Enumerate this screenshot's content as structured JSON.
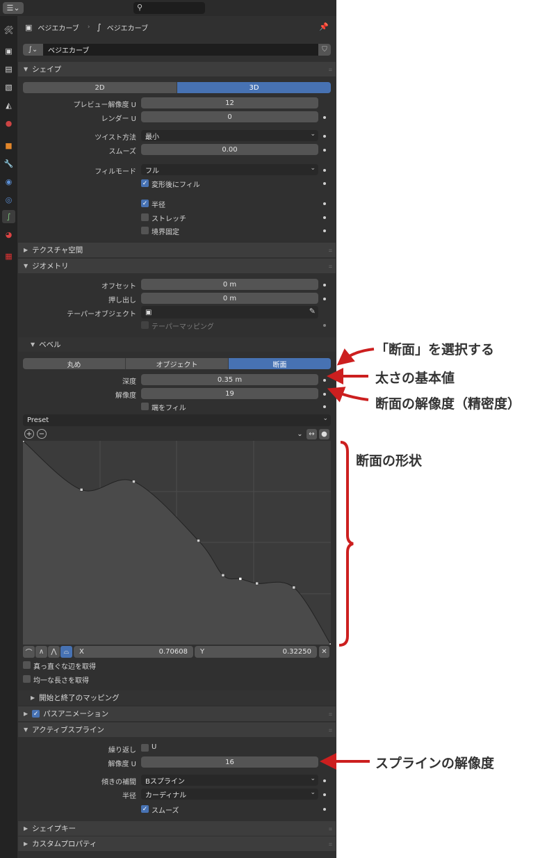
{
  "search": {
    "placeholder": ""
  },
  "header": {
    "object_name": "ベジエカーブ",
    "data_name": "ベジエカーブ",
    "datablock_name": "ベジエカーブ"
  },
  "panels": {
    "shape": "シェイプ",
    "texture_space": "テクスチャ空間",
    "geometry": "ジオメトリ",
    "bevel": "ベベル",
    "start_end_mapping": "開始と終了のマッピング",
    "path_animation": "パスアニメーション",
    "active_spline": "アクティブスプライン",
    "shape_keys": "シェイプキー",
    "custom_props": "カスタムプロパティ"
  },
  "shape": {
    "dims": [
      "2D",
      "3D"
    ],
    "preview_res_label": "プレビュー解像度 U",
    "preview_res": "12",
    "render_res_label": "レンダー U",
    "render_res": "0",
    "twist_label": "ツイスト方法",
    "twist": "最小",
    "smooth_label": "スムーズ",
    "smooth": "0.00",
    "fill_label": "フィルモード",
    "fill": "フル",
    "fill_deform": "変形後にフィル",
    "radius": "半径",
    "stretch": "ストレッチ",
    "bounds_clamp": "境界固定"
  },
  "geometry": {
    "offset_label": "オフセット",
    "offset": "0 m",
    "extrude_label": "押し出し",
    "extrude": "0 m",
    "taper_label": "テーパーオブジェクト",
    "taper_mapping": "テーパーマッピング"
  },
  "bevel": {
    "modes": [
      "丸め",
      "オブジェクト",
      "断面"
    ],
    "depth_label": "深度",
    "depth": "0.35 m",
    "resolution_label": "解像度",
    "resolution": "19",
    "fill_caps": "端をフィル",
    "preset": "Preset",
    "x_label": "X",
    "x_value": "0.70608",
    "y_label": "Y",
    "y_value": "0.32250",
    "straight_edges": "真っ直ぐな辺を取得",
    "even_lengths": "均一な長さを取得"
  },
  "active_spline": {
    "cyclic_label": "繰り返し",
    "cyclic_u": "U",
    "res_label": "解像度 U",
    "res": "16",
    "tilt_label": "傾きの補間",
    "tilt": "Bスプライン",
    "radius_label": "半径",
    "radius": "カーディナル",
    "smooth": "スムーズ"
  },
  "annotations": {
    "select_profile": "「断面」を選択する",
    "base_thickness": "太さの基本値",
    "profile_resolution": "断面の解像度（精密度）",
    "profile_shape": "断面の形状",
    "spline_resolution": "スプラインの解像度"
  },
  "colors": {
    "accent": "#4772b3",
    "annotation_arrow": "#cc1f1f"
  },
  "curve_points": [
    [
      0.0,
      1.0
    ],
    [
      0.19,
      0.76
    ],
    [
      0.36,
      0.8
    ],
    [
      0.57,
      0.51
    ],
    [
      0.65,
      0.34
    ],
    [
      0.7061,
      0.3225
    ],
    [
      0.76,
      0.3
    ],
    [
      0.88,
      0.28
    ],
    [
      1.0,
      0.0
    ]
  ]
}
